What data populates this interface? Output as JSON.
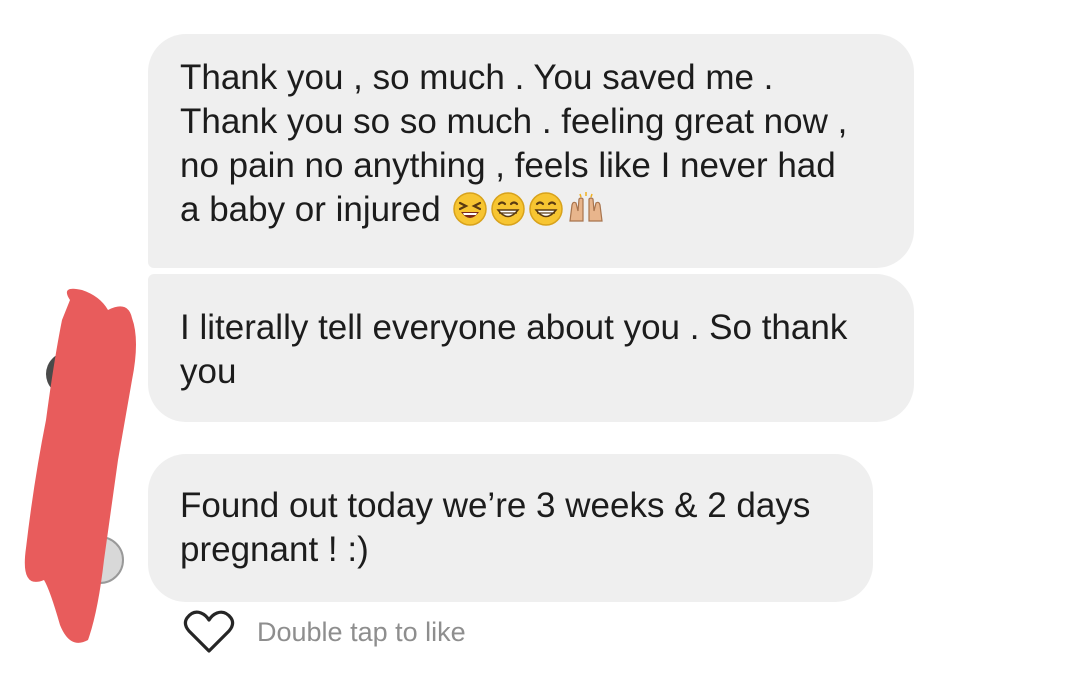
{
  "messages": [
    {
      "text": "Thank you , so much . You saved me .\nThank you so so much . feeling great now ,\nno pain no anything , feels like I never had\na baby or injured ",
      "emojis": [
        "laughing-face-emoji",
        "grinning-face-emoji",
        "grinning-face-emoji",
        "raising-hands-emoji"
      ]
    },
    {
      "text": "I literally tell everyone about you . So thank\nyou"
    },
    {
      "text": "Found out today we’re 3 weeks & 2 days\npregnant ! :)"
    }
  ],
  "like": {
    "icon": "heart-outline-icon",
    "label": "Double tap to like"
  },
  "colors": {
    "bubble": "#efefef",
    "text": "#1c1c1c",
    "secondary_text": "#8e8e8e",
    "redaction": "#e85c5c",
    "outgoing_border": "#3d4a9b"
  }
}
